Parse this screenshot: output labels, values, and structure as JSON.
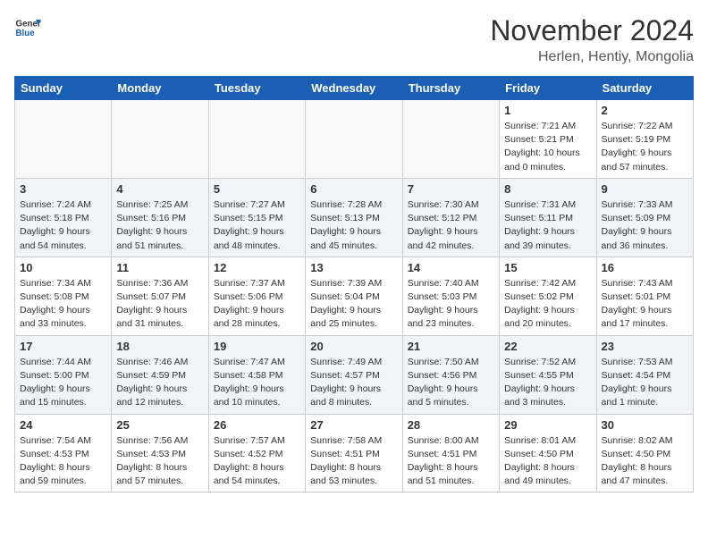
{
  "header": {
    "logo": {
      "general": "General",
      "blue": "Blue"
    },
    "title": "November 2024",
    "location": "Herlen, Hentiy, Mongolia"
  },
  "weekdays": [
    "Sunday",
    "Monday",
    "Tuesday",
    "Wednesday",
    "Thursday",
    "Friday",
    "Saturday"
  ],
  "weeks": [
    [
      {
        "day": "",
        "empty": true
      },
      {
        "day": "",
        "empty": true
      },
      {
        "day": "",
        "empty": true
      },
      {
        "day": "",
        "empty": true
      },
      {
        "day": "",
        "empty": true
      },
      {
        "day": "1",
        "sunrise": "7:21 AM",
        "sunset": "5:21 PM",
        "daylight": "10 hours and 0 minutes."
      },
      {
        "day": "2",
        "sunrise": "7:22 AM",
        "sunset": "5:19 PM",
        "daylight": "9 hours and 57 minutes."
      }
    ],
    [
      {
        "day": "3",
        "sunrise": "7:24 AM",
        "sunset": "5:18 PM",
        "daylight": "9 hours and 54 minutes."
      },
      {
        "day": "4",
        "sunrise": "7:25 AM",
        "sunset": "5:16 PM",
        "daylight": "9 hours and 51 minutes."
      },
      {
        "day": "5",
        "sunrise": "7:27 AM",
        "sunset": "5:15 PM",
        "daylight": "9 hours and 48 minutes."
      },
      {
        "day": "6",
        "sunrise": "7:28 AM",
        "sunset": "5:13 PM",
        "daylight": "9 hours and 45 minutes."
      },
      {
        "day": "7",
        "sunrise": "7:30 AM",
        "sunset": "5:12 PM",
        "daylight": "9 hours and 42 minutes."
      },
      {
        "day": "8",
        "sunrise": "7:31 AM",
        "sunset": "5:11 PM",
        "daylight": "9 hours and 39 minutes."
      },
      {
        "day": "9",
        "sunrise": "7:33 AM",
        "sunset": "5:09 PM",
        "daylight": "9 hours and 36 minutes."
      }
    ],
    [
      {
        "day": "10",
        "sunrise": "7:34 AM",
        "sunset": "5:08 PM",
        "daylight": "9 hours and 33 minutes."
      },
      {
        "day": "11",
        "sunrise": "7:36 AM",
        "sunset": "5:07 PM",
        "daylight": "9 hours and 31 minutes."
      },
      {
        "day": "12",
        "sunrise": "7:37 AM",
        "sunset": "5:06 PM",
        "daylight": "9 hours and 28 minutes."
      },
      {
        "day": "13",
        "sunrise": "7:39 AM",
        "sunset": "5:04 PM",
        "daylight": "9 hours and 25 minutes."
      },
      {
        "day": "14",
        "sunrise": "7:40 AM",
        "sunset": "5:03 PM",
        "daylight": "9 hours and 23 minutes."
      },
      {
        "day": "15",
        "sunrise": "7:42 AM",
        "sunset": "5:02 PM",
        "daylight": "9 hours and 20 minutes."
      },
      {
        "day": "16",
        "sunrise": "7:43 AM",
        "sunset": "5:01 PM",
        "daylight": "9 hours and 17 minutes."
      }
    ],
    [
      {
        "day": "17",
        "sunrise": "7:44 AM",
        "sunset": "5:00 PM",
        "daylight": "9 hours and 15 minutes."
      },
      {
        "day": "18",
        "sunrise": "7:46 AM",
        "sunset": "4:59 PM",
        "daylight": "9 hours and 12 minutes."
      },
      {
        "day": "19",
        "sunrise": "7:47 AM",
        "sunset": "4:58 PM",
        "daylight": "9 hours and 10 minutes."
      },
      {
        "day": "20",
        "sunrise": "7:49 AM",
        "sunset": "4:57 PM",
        "daylight": "9 hours and 8 minutes."
      },
      {
        "day": "21",
        "sunrise": "7:50 AM",
        "sunset": "4:56 PM",
        "daylight": "9 hours and 5 minutes."
      },
      {
        "day": "22",
        "sunrise": "7:52 AM",
        "sunset": "4:55 PM",
        "daylight": "9 hours and 3 minutes."
      },
      {
        "day": "23",
        "sunrise": "7:53 AM",
        "sunset": "4:54 PM",
        "daylight": "9 hours and 1 minute."
      }
    ],
    [
      {
        "day": "24",
        "sunrise": "7:54 AM",
        "sunset": "4:53 PM",
        "daylight": "8 hours and 59 minutes."
      },
      {
        "day": "25",
        "sunrise": "7:56 AM",
        "sunset": "4:53 PM",
        "daylight": "8 hours and 57 minutes."
      },
      {
        "day": "26",
        "sunrise": "7:57 AM",
        "sunset": "4:52 PM",
        "daylight": "8 hours and 54 minutes."
      },
      {
        "day": "27",
        "sunrise": "7:58 AM",
        "sunset": "4:51 PM",
        "daylight": "8 hours and 53 minutes."
      },
      {
        "day": "28",
        "sunrise": "8:00 AM",
        "sunset": "4:51 PM",
        "daylight": "8 hours and 51 minutes."
      },
      {
        "day": "29",
        "sunrise": "8:01 AM",
        "sunset": "4:50 PM",
        "daylight": "8 hours and 49 minutes."
      },
      {
        "day": "30",
        "sunrise": "8:02 AM",
        "sunset": "4:50 PM",
        "daylight": "8 hours and 47 minutes."
      }
    ]
  ],
  "labels": {
    "sunrise": "Sunrise:",
    "sunset": "Sunset:",
    "daylight": "Daylight:"
  }
}
